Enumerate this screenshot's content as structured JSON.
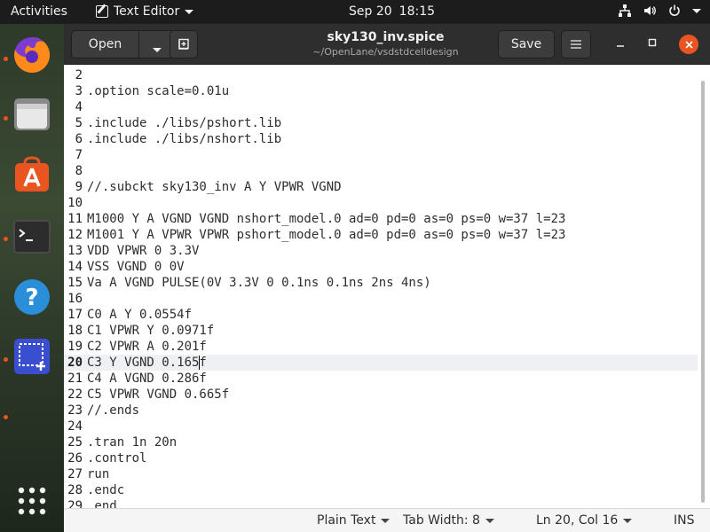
{
  "topbar": {
    "activities": "Activities",
    "app_name": "Text Editor",
    "date": "Sep 20",
    "time": "18:15"
  },
  "dock": {
    "items": [
      {
        "name": "firefox-icon",
        "running": true
      },
      {
        "name": "files-icon",
        "running": true
      },
      {
        "name": "software-icon",
        "running": false
      },
      {
        "name": "terminal-icon",
        "running": true
      },
      {
        "name": "help-icon",
        "running": false
      },
      {
        "name": "screenshot-icon",
        "running": true
      }
    ],
    "apps_grid_icon": "apps-grid-icon"
  },
  "window": {
    "open_label": "Open",
    "save_label": "Save",
    "file_name": "sky130_inv.spice",
    "file_path": "~/OpenLane/vsdstdcelldesign",
    "accent_close": "#e95420"
  },
  "editor": {
    "current_line": 20,
    "lines": [
      {
        "n": "2",
        "text": ""
      },
      {
        "n": "3",
        "text": ".option scale=0.01u"
      },
      {
        "n": "4",
        "text": ""
      },
      {
        "n": "5",
        "text": ".include ./libs/pshort.lib"
      },
      {
        "n": "6",
        "text": ".include ./libs/nshort.lib"
      },
      {
        "n": "7",
        "text": ""
      },
      {
        "n": "8",
        "text": ""
      },
      {
        "n": "9",
        "text": "//.subckt sky130_inv A Y VPWR VGND"
      },
      {
        "n": "10",
        "text": ""
      },
      {
        "n": "11",
        "text": "M1000 Y A VGND VGND nshort_model.0 ad=0 pd=0 as=0 ps=0 w=37 l=23"
      },
      {
        "n": "12",
        "text": "M1001 Y A VPWR VPWR pshort_model.0 ad=0 pd=0 as=0 ps=0 w=37 l=23"
      },
      {
        "n": "13",
        "text": "VDD VPWR 0 3.3V"
      },
      {
        "n": "14",
        "text": "VSS VGND 0 0V"
      },
      {
        "n": "15",
        "text": "Va A VGND PULSE(0V 3.3V 0 0.1ns 0.1ns 2ns 4ns)"
      },
      {
        "n": "16",
        "text": ""
      },
      {
        "n": "17",
        "text": "C0 A Y 0.0554f"
      },
      {
        "n": "18",
        "text": "C1 VPWR Y 0.0971f"
      },
      {
        "n": "19",
        "text": "C2 VPWR A 0.201f"
      },
      {
        "n": "20",
        "text": "C3 Y VGND 0.165f"
      },
      {
        "n": "21",
        "text": "C4 A VGND 0.286f"
      },
      {
        "n": "22",
        "text": "C5 VPWR VGND 0.665f"
      },
      {
        "n": "23",
        "text": "//.ends"
      },
      {
        "n": "24",
        "text": ""
      },
      {
        "n": "25",
        "text": ".tran 1n 20n"
      },
      {
        "n": "26",
        "text": ".control"
      },
      {
        "n": "27",
        "text": "run"
      },
      {
        "n": "28",
        "text": ".endc"
      },
      {
        "n": "29",
        "text": ".end"
      }
    ]
  },
  "statusbar": {
    "language": "Plain Text",
    "tab_width": "Tab Width: 8",
    "position": "Ln 20, Col 16",
    "mode": "INS"
  }
}
